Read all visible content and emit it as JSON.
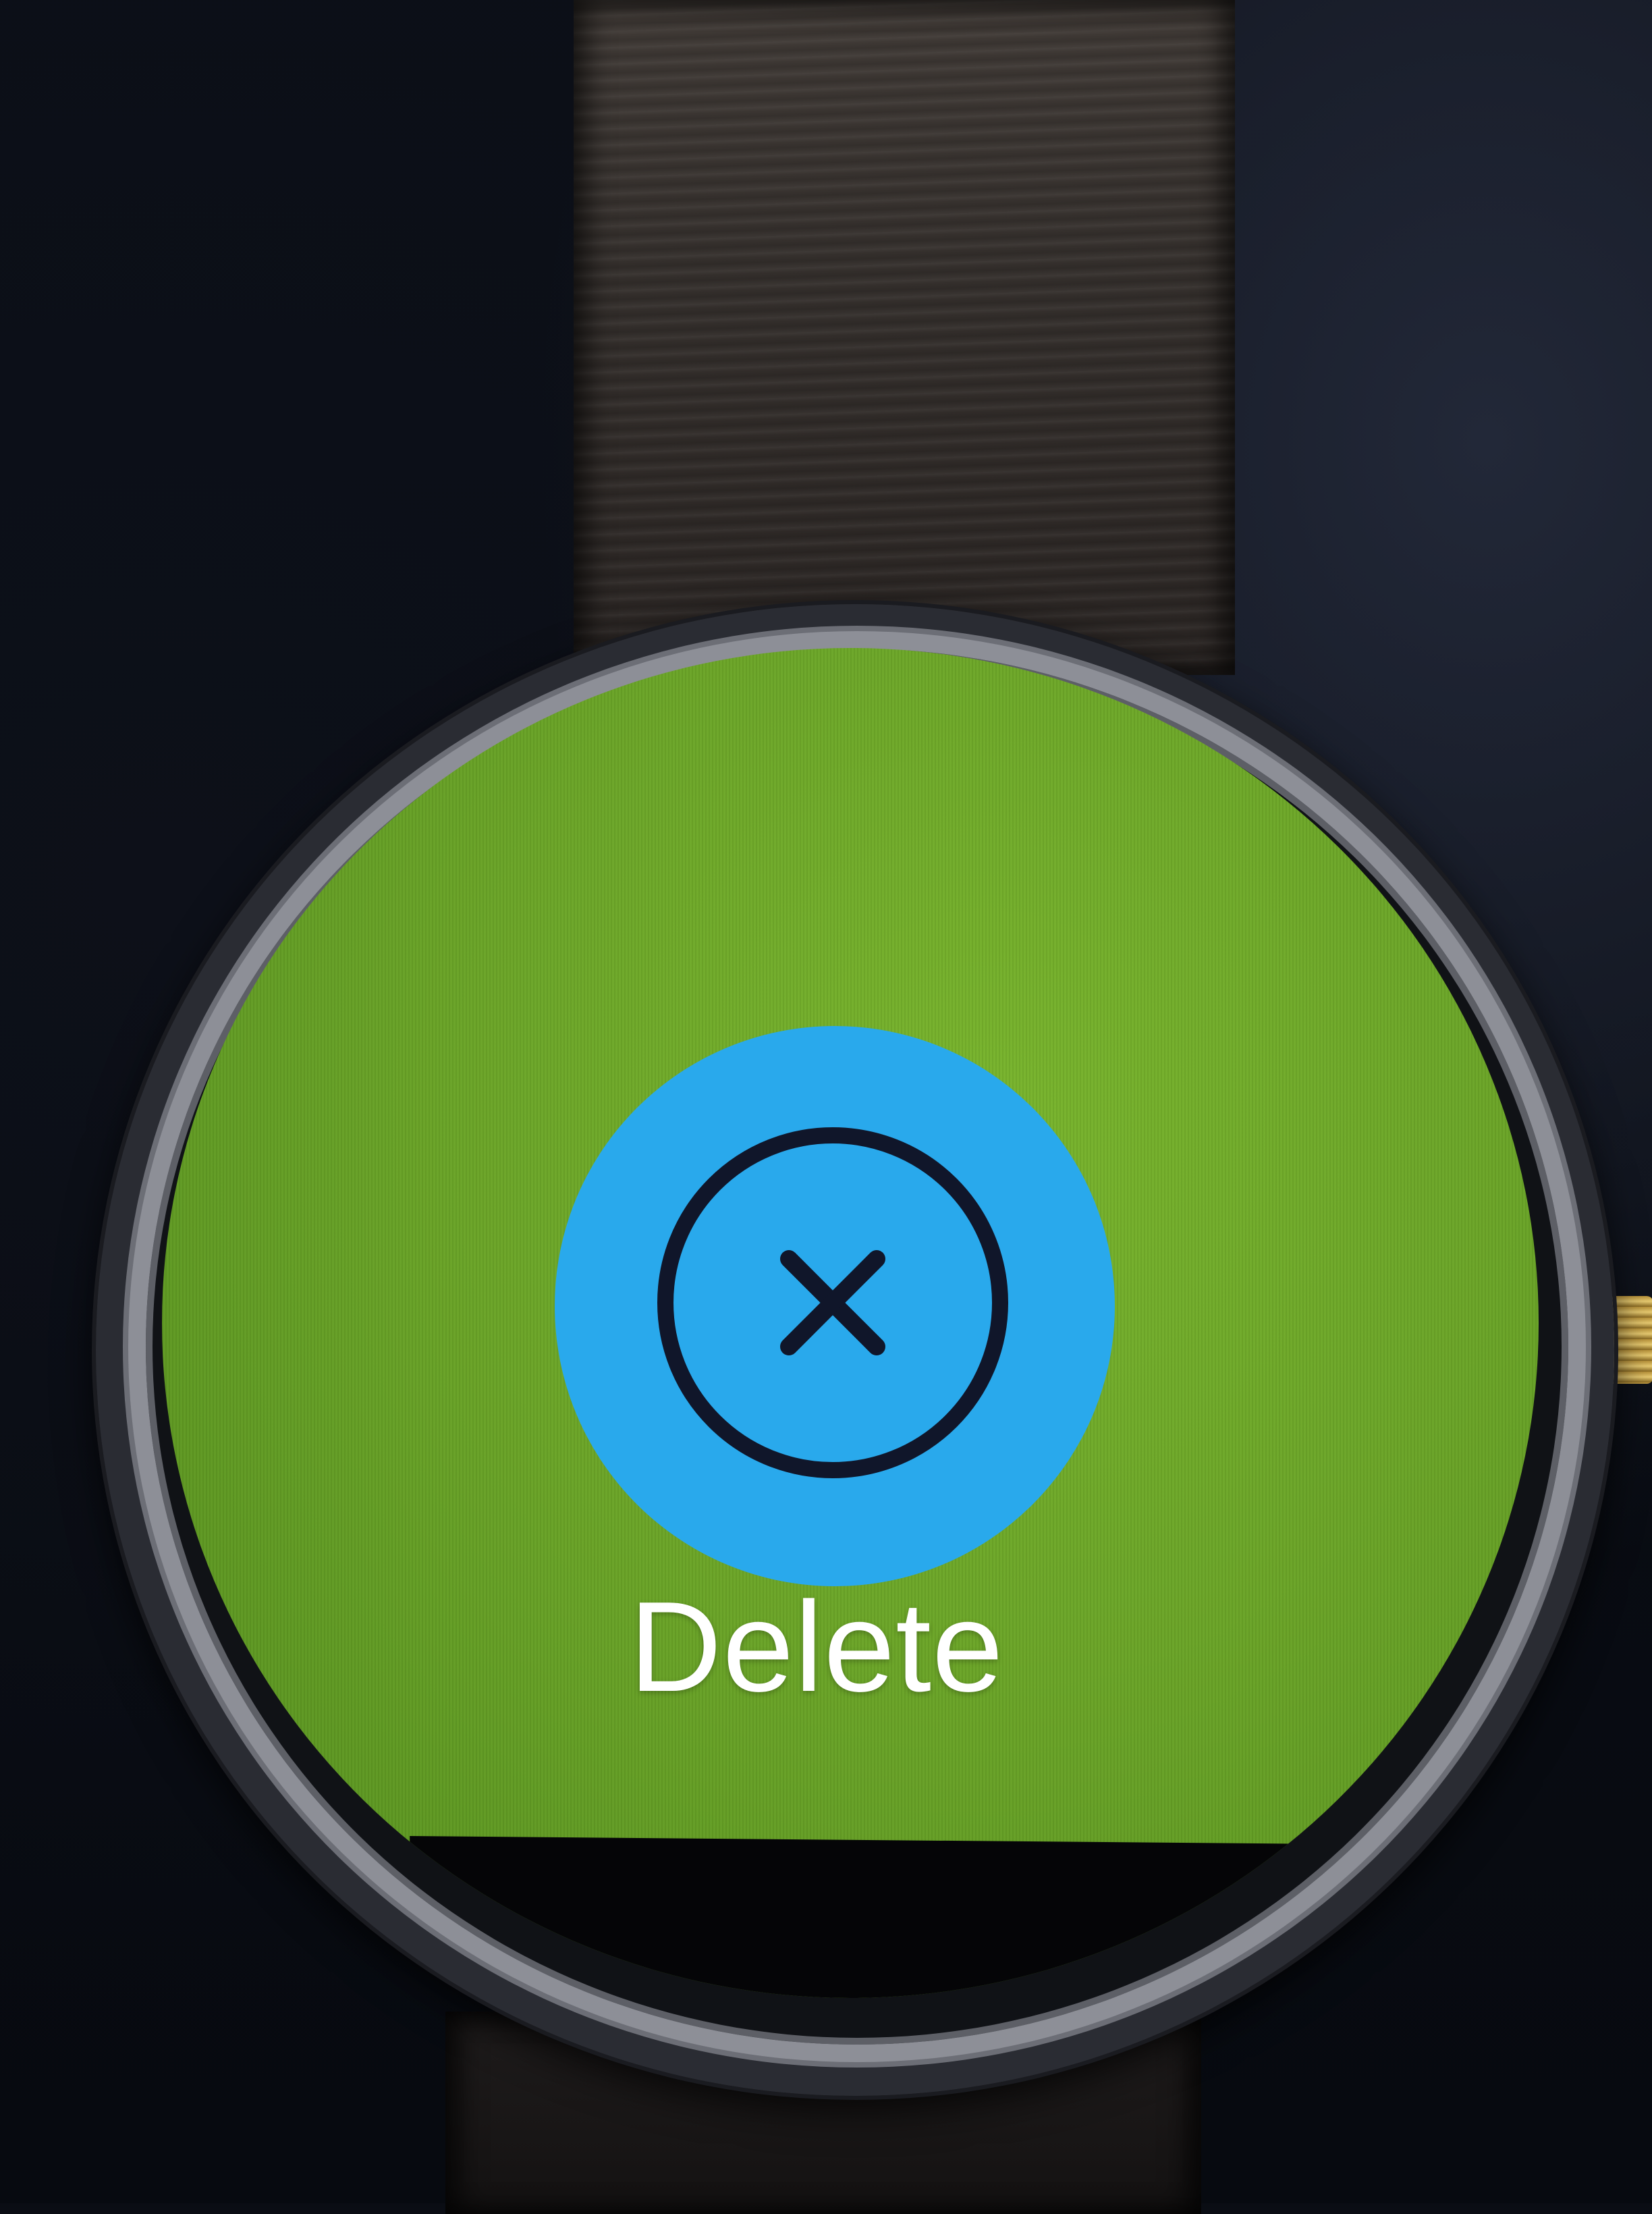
{
  "screen": {
    "background_color": "#6aa427",
    "action": {
      "icon": "cancel-circle-x-icon",
      "button_color": "#29a9ec",
      "label": "Delete"
    }
  }
}
